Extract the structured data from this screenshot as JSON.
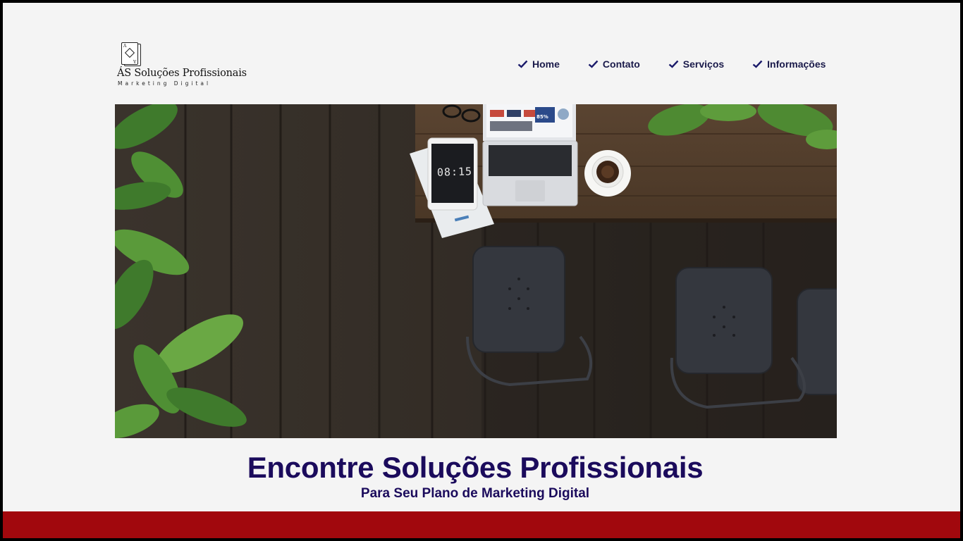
{
  "brand": {
    "name": "ÁS Soluções Profissionais",
    "tagline": "Marketing Digital",
    "card_letter": "A"
  },
  "nav": {
    "items": [
      {
        "label": "Home",
        "icon": "check-icon"
      },
      {
        "label": "Contato",
        "icon": "check-icon"
      },
      {
        "label": "Serviços",
        "icon": "check-icon"
      },
      {
        "label": "Informações",
        "icon": "check-icon"
      }
    ]
  },
  "hero": {
    "tablet_clock": "08:15",
    "laptop_screen_stat": "85%"
  },
  "headline": {
    "title": "Encontre Soluções Profissionais",
    "subtitle": "Para Seu Plano de Marketing Digital"
  },
  "colors": {
    "nav_text": "#1a1a4a",
    "headline": "#1b0b5c",
    "footer_bar": "#a1080d",
    "page_bg": "#f4f4f4"
  }
}
